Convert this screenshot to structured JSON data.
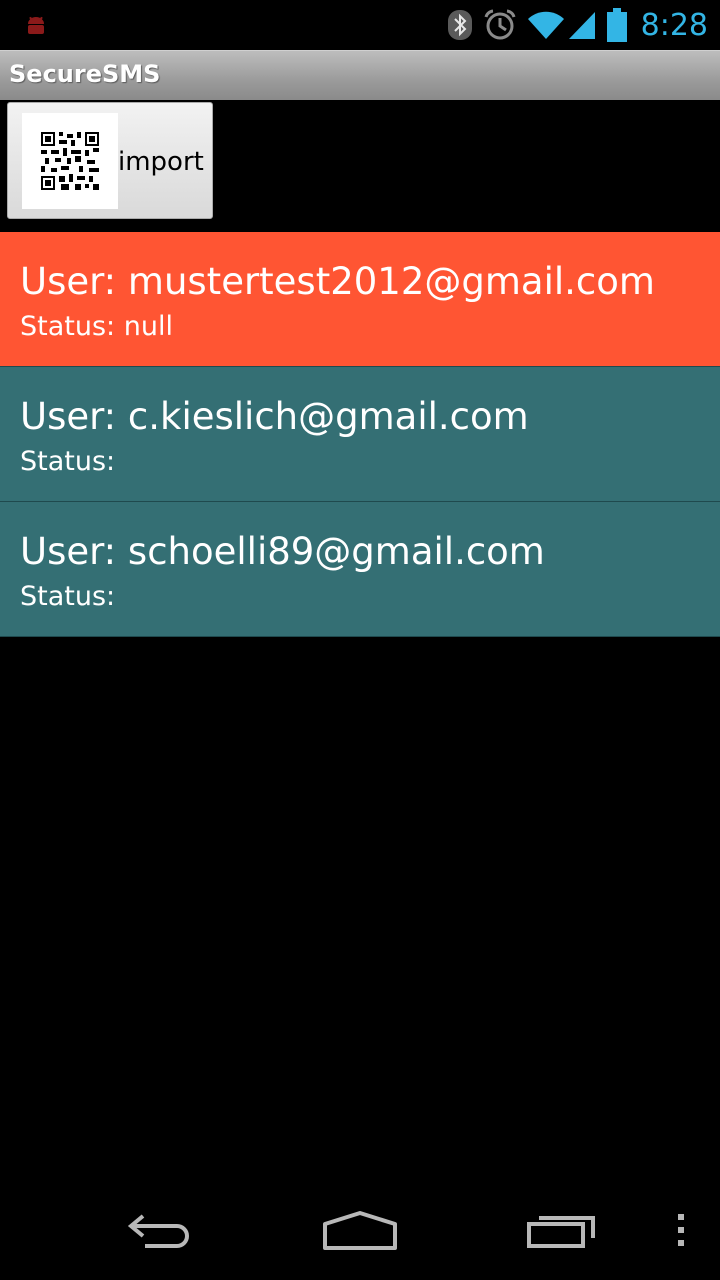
{
  "status_bar": {
    "time": "8:28",
    "accent_color": "#33b5e5",
    "icons": [
      "android-notification-icon",
      "bluetooth-icon",
      "alarm-icon",
      "wifi-icon",
      "signal-icon",
      "battery-icon"
    ]
  },
  "app": {
    "title": "SecureSMS"
  },
  "toolbar": {
    "import_label": "import",
    "import_icon": "qr-code-icon"
  },
  "users": [
    {
      "user_text": "User: mustertest2012@gmail.com",
      "status_text": "Status: null",
      "color": "#ff5533"
    },
    {
      "user_text": "User: c.kieslich@gmail.com",
      "status_text": "Status:",
      "color": "#346f74"
    },
    {
      "user_text": "User: schoelli89@gmail.com",
      "status_text": "Status:",
      "color": "#346f74"
    }
  ],
  "nav_bar": {
    "icons": [
      "back-icon",
      "home-icon",
      "recent-apps-icon",
      "overflow-menu-icon"
    ]
  }
}
